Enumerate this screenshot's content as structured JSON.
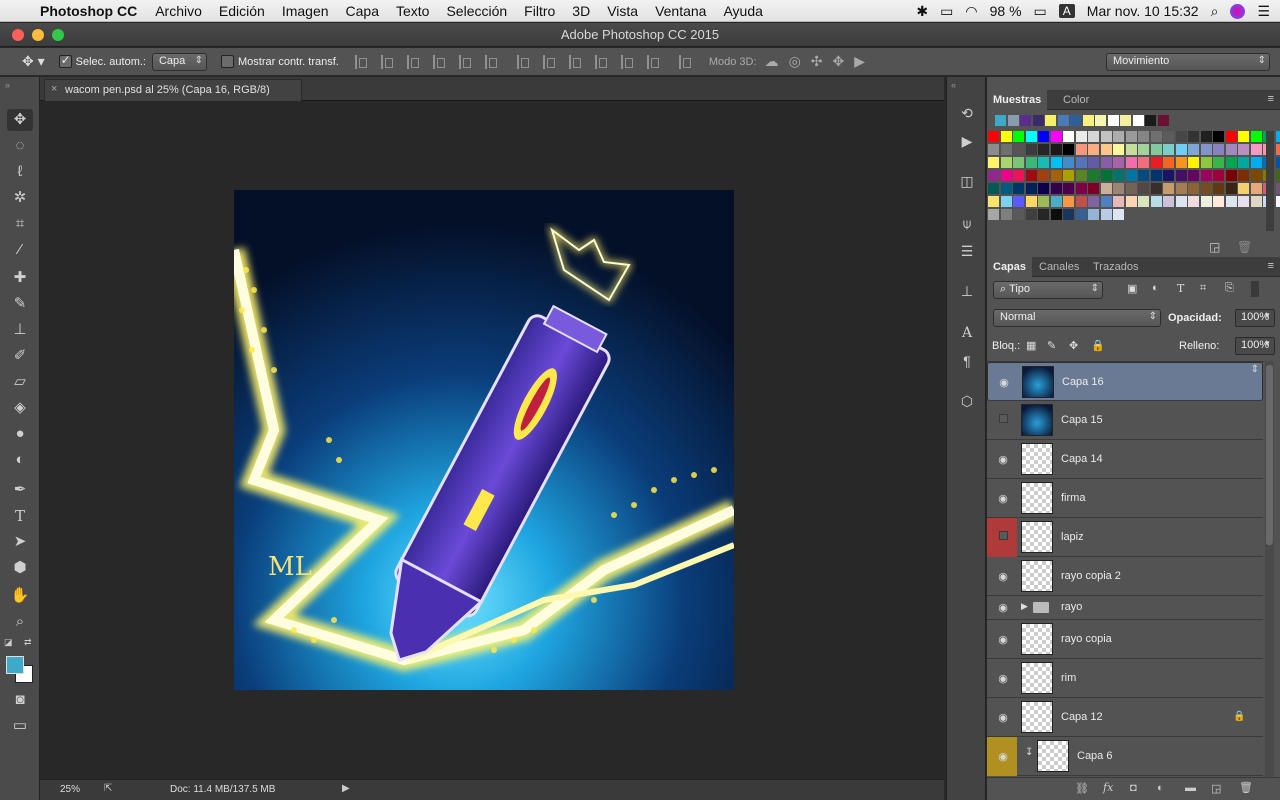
{
  "menubar": {
    "app_name": "Photoshop CC",
    "items": [
      "Archivo",
      "Edición",
      "Imagen",
      "Capa",
      "Texto",
      "Selección",
      "Filtro",
      "3D",
      "Vista",
      "Ventana",
      "Ayuda"
    ],
    "battery": "98 %",
    "input_source": "A",
    "clock": "Mar nov. 10  15:32"
  },
  "window": {
    "title": "Adobe Photoshop CC 2015"
  },
  "options": {
    "auto_select_label": "Selec. autom.:",
    "auto_select_value": "Capa",
    "transform_label": "Mostrar contr. transf.",
    "mode3d_label": "Modo 3D:",
    "workspace_value": "Movimiento"
  },
  "document": {
    "tab_title": "wacom pen.psd al 25% (Capa 16, RGB/8)"
  },
  "status": {
    "zoom": "25%",
    "doc_size": "Doc: 11.4 MB/137.5 MB"
  },
  "swatches_panel": {
    "tabs": [
      "Muestras",
      "Color"
    ],
    "recent": [
      "#3fa9c9",
      "#8a9bb0",
      "#5b2d8a",
      "#3a2a6a",
      "#f6ef6a",
      "#4a7ab8",
      "#2f5f9a",
      "#f8f080",
      "#f5f5b0",
      "#ffffff",
      "#f5f0a0",
      "#ffffff",
      "#1a1a1a",
      "#6a1030"
    ],
    "grid": [
      [
        "#ff0000",
        "#ffff00",
        "#00ff00",
        "#00ffff",
        "#0000ff",
        "#ff00ff",
        "#ffffff",
        "#ebebeb",
        "#d6d6d6",
        "#c2c2c2",
        "#adadad",
        "#999999",
        "#858585",
        "#707070",
        "#5c5c5c",
        "#474747",
        "#333333",
        "#1f1f1f",
        "#000000",
        "#ff0000",
        "#ffff00",
        "#00ff00",
        "#00a650",
        "#00aeef",
        "#2e3192",
        "#ec008c"
      ],
      [
        "#8c8c8c",
        "#707070",
        "#555555",
        "#3b3b3b",
        "#262626",
        "#1a1a1a",
        "#000000",
        "#f7977a",
        "#f9ad81",
        "#fdc68a",
        "#fff79a",
        "#c4df9b",
        "#a2d39c",
        "#82ca9d",
        "#7bcdc8",
        "#6ecff6",
        "#7ea7d8",
        "#8493ca",
        "#8882be",
        "#a187be",
        "#bc8dbf",
        "#f49ac2",
        "#f6989d",
        "#f26c4f",
        "#f68e55",
        "#fbaf5c"
      ],
      [
        "#fff467",
        "#acd372",
        "#7cc576",
        "#3bb878",
        "#1abbb4",
        "#00bff3",
        "#438ccb",
        "#5574b9",
        "#605ca8",
        "#855fa8",
        "#a763a8",
        "#f06ea9",
        "#f26d7d",
        "#ed1c24",
        "#f26522",
        "#f7941d",
        "#fff200",
        "#8dc73f",
        "#39b54a",
        "#00a651",
        "#00a99d",
        "#00aeef",
        "#0072bc",
        "#0054a6",
        "#2e3192",
        "#662d91"
      ],
      [
        "#92278f",
        "#ec008c",
        "#ed145b",
        "#9e0b0f",
        "#a0410d",
        "#a3620a",
        "#aba000",
        "#598527",
        "#197b30",
        "#007236",
        "#00746b",
        "#0076a3",
        "#004b80",
        "#003471",
        "#1b1464",
        "#440e62",
        "#630460",
        "#9e005d",
        "#9e0039",
        "#790000",
        "#7b2e00",
        "#7d4900",
        "#827b00",
        "#406618",
        "#005e20",
        "#005826"
      ],
      [
        "#005952",
        "#005b7f",
        "#003663",
        "#002157",
        "#0d004c",
        "#32004b",
        "#4b0049",
        "#7b0046",
        "#7a0026",
        "#c7b299",
        "#998675",
        "#736357",
        "#534741",
        "#372f2a",
        "#c69c6d",
        "#a67c52",
        "#8c6239",
        "#754c24",
        "#603913",
        "#3c2415",
        "#f4d06f",
        "#e8a87c",
        "#d45d79",
        "#6e5773",
        "#385f71",
        "#8fb339"
      ],
      [
        "#f7e26b",
        "#7cd1f0",
        "#5a5aff",
        "#ffd966",
        "#9bbb59",
        "#4bacc6",
        "#f79646",
        "#c0504d",
        "#8064a2",
        "#4f81bd",
        "#e6b8b7",
        "#fcd5b4",
        "#d7e4bc",
        "#b7dee8",
        "#ccc0da",
        "#dbe5f1",
        "#f2dcdb",
        "#ebf1de",
        "#fde9d9",
        "#dae5f0",
        "#e5e0ec",
        "#ddd9c3",
        "#c6d9f0",
        "#f9f9f9",
        "#d9d9d9",
        "#bfbfbf"
      ],
      [
        "#a6a6a6",
        "#7f7f7f",
        "#595959",
        "#3f3f3f",
        "#262626",
        "#0d0d0d",
        "#17375e",
        "#366092",
        "#95b3d7",
        "#b8cce4",
        "#dce6f1"
      ]
    ]
  },
  "layers_panel": {
    "tabs": [
      "Capas",
      "Canales",
      "Trazados"
    ],
    "filter_label": "⌕ Tipo",
    "blend_mode": "Normal",
    "opacity_label": "Opacidad:",
    "opacity_value": "100%",
    "lock_label": "Bloq.:",
    "fill_label": "Relleno:",
    "fill_value": "100%",
    "layers": [
      {
        "name": "Capa 16",
        "visible": true,
        "selected": true,
        "thumb": "art"
      },
      {
        "name": "Capa 15",
        "visible": false,
        "selected": false,
        "thumb": "art"
      },
      {
        "name": "Capa 14",
        "visible": true,
        "selected": false,
        "thumb": "empty"
      },
      {
        "name": "firma",
        "visible": true,
        "selected": false,
        "thumb": "empty"
      },
      {
        "name": "lapiz",
        "visible": false,
        "selected": false,
        "thumb": "empty",
        "color_tag": "#b03a3a"
      },
      {
        "name": "rayo copia 2",
        "visible": true,
        "selected": false,
        "thumb": "empty"
      },
      {
        "name": "rayo",
        "visible": true,
        "selected": false,
        "thumb": "folder"
      },
      {
        "name": "rayo copia",
        "visible": true,
        "selected": false,
        "thumb": "empty"
      },
      {
        "name": "rim",
        "visible": true,
        "selected": false,
        "thumb": "empty"
      },
      {
        "name": "Capa 12",
        "visible": true,
        "selected": false,
        "thumb": "empty",
        "locked": true
      },
      {
        "name": "Capa 6",
        "visible": true,
        "selected": false,
        "thumb": "empty",
        "clipped": true,
        "color_tag": "#b09020"
      }
    ]
  },
  "colors": {
    "foreground": "#3fa9c9",
    "background": "#ffffff",
    "selected_layer": "#6a7a95",
    "panel_bg": "#535353"
  }
}
